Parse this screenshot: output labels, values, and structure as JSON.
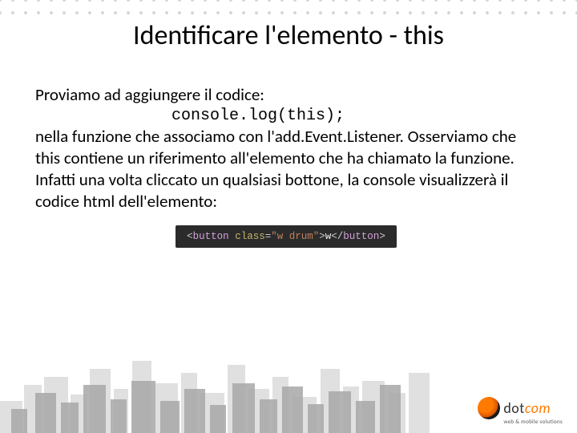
{
  "title": "Identificare l'elemento - this",
  "p1": "Proviamo ad aggiungere il codice:",
  "code1": "console.log(this);",
  "p2": "nella funzione che associamo con l'add.Event.Listener. Osserviamo che this contiene un riferimento all'elemento che ha chiamato la funzione. Infatti una volta cliccato un qualsiasi bottone, la console visualizzerà il codice html dell'elemento:",
  "snippet": {
    "open_tag": "button",
    "attr_name": "class",
    "attr_value": "\"w drum\"",
    "inner_text": "w",
    "close_tag": "button"
  },
  "logo": {
    "main1": "dot",
    "main2": "com",
    "tagline": "web & mobile solutions"
  }
}
